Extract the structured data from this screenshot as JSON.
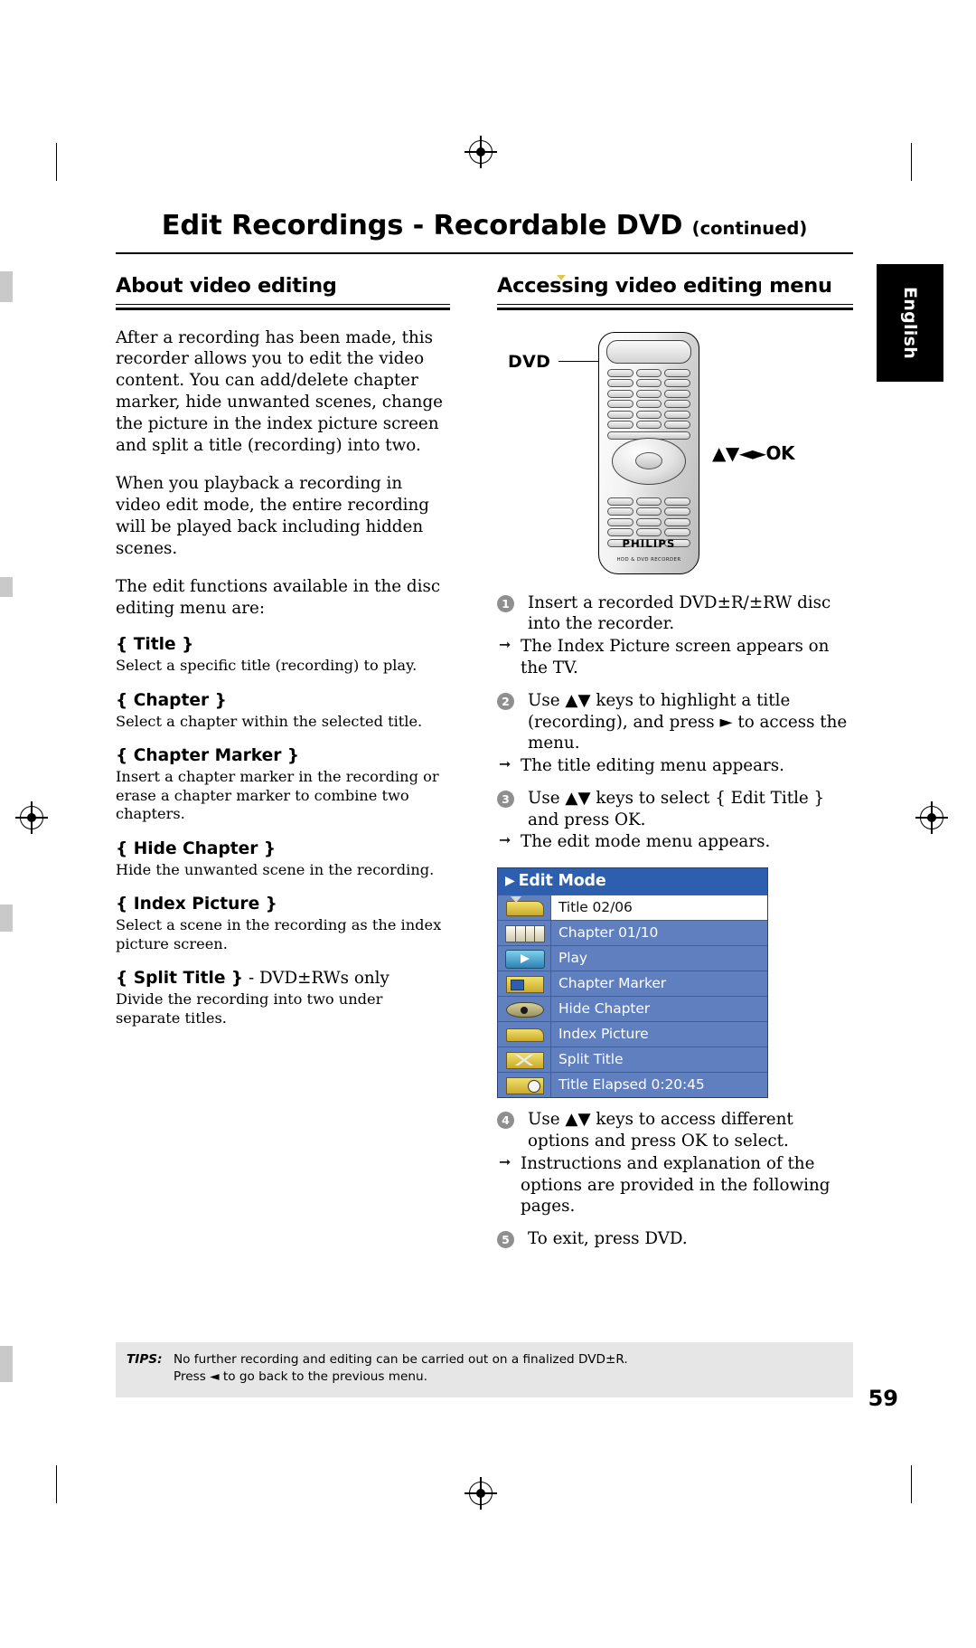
{
  "header": {
    "title": "Edit Recordings - Recordable DVD",
    "title_suffix": "(continued)"
  },
  "side_tab": {
    "label": "English"
  },
  "left_column": {
    "heading": "About video editing",
    "paragraphs": [
      "After a recording has been made, this recorder allows you to edit the video content. You can add/delete chapter marker, hide unwanted scenes, change the picture in the index picture screen and split a title (recording) into two.",
      "When you playback a recording in video edit mode, the entire recording will be played back including hidden scenes.",
      "The edit functions available in the disc editing menu are:"
    ],
    "definitions": [
      {
        "term": "{ Title }",
        "suffix": "",
        "desc": "Select a specific title (recording) to play."
      },
      {
        "term": "{ Chapter }",
        "suffix": "",
        "desc": "Select a chapter within the selected title."
      },
      {
        "term": "{ Chapter Marker }",
        "suffix": "",
        "desc": "Insert a chapter marker in the recording or erase a chapter marker to combine two chapters."
      },
      {
        "term": "{ Hide Chapter }",
        "suffix": "",
        "desc": "Hide the unwanted scene in the recording."
      },
      {
        "term": "{ Index Picture }",
        "suffix": "",
        "desc": "Select a scene in the recording as the index picture screen."
      },
      {
        "term": "{ Split Title }",
        "suffix": " - DVD±RWs only",
        "desc": "Divide the recording into two under separate titles."
      }
    ]
  },
  "right_column": {
    "heading": "Accessing video editing menu",
    "remote": {
      "dvd_label": "DVD",
      "nav_label": "▲▼◄►OK",
      "brand": "PHILIPS",
      "brand_sub": "HDD & DVD RECORDER"
    },
    "steps": [
      {
        "num": "1",
        "text": "Insert a recorded DVD±R/±RW disc into the recorder.",
        "subs": [
          "The Index Picture screen appears on the TV."
        ]
      },
      {
        "num": "2",
        "text": "Use ▲▼ keys to highlight a title (recording), and press ► to access the menu.",
        "subs": [
          "The title editing menu appears."
        ]
      },
      {
        "num": "3",
        "text": "Use ▲▼ keys to select { Edit Title } and press OK.",
        "subs": [
          "The edit mode menu appears."
        ]
      },
      {
        "num": "4",
        "text": "Use ▲▼ keys to access different options and press OK to select.",
        "subs": [
          "Instructions and explanation of the options are provided in the following pages."
        ]
      },
      {
        "num": "5",
        "text": "To exit, press DVD.",
        "subs": []
      }
    ],
    "osd": {
      "title": "Edit Mode",
      "rows": [
        {
          "label": "Title 02/06",
          "icon": "tape-down-icon",
          "selected": true
        },
        {
          "label": "Chapter 01/10",
          "icon": "filmstrip-icon",
          "selected": false
        },
        {
          "label": "Play",
          "icon": "play-icon",
          "selected": false
        },
        {
          "label": "Chapter Marker",
          "icon": "chapter-marker-icon",
          "selected": false
        },
        {
          "label": "Hide Chapter",
          "icon": "eye-icon",
          "selected": false
        },
        {
          "label": "Index Picture",
          "icon": "index-picture-icon",
          "selected": false
        },
        {
          "label": "Split Title",
          "icon": "scissors-icon",
          "selected": false
        },
        {
          "label": "Title Elapsed 0:20:45",
          "icon": "clock-icon",
          "selected": false
        }
      ]
    }
  },
  "tips": {
    "label": "TIPS:",
    "line1": "No further recording and editing can be carried out on a finalized DVD±R.",
    "line2_prefix": "Press ",
    "line2_glyph": "◄",
    "line2_suffix": " to go back to the previous menu."
  },
  "page_number": "59"
}
